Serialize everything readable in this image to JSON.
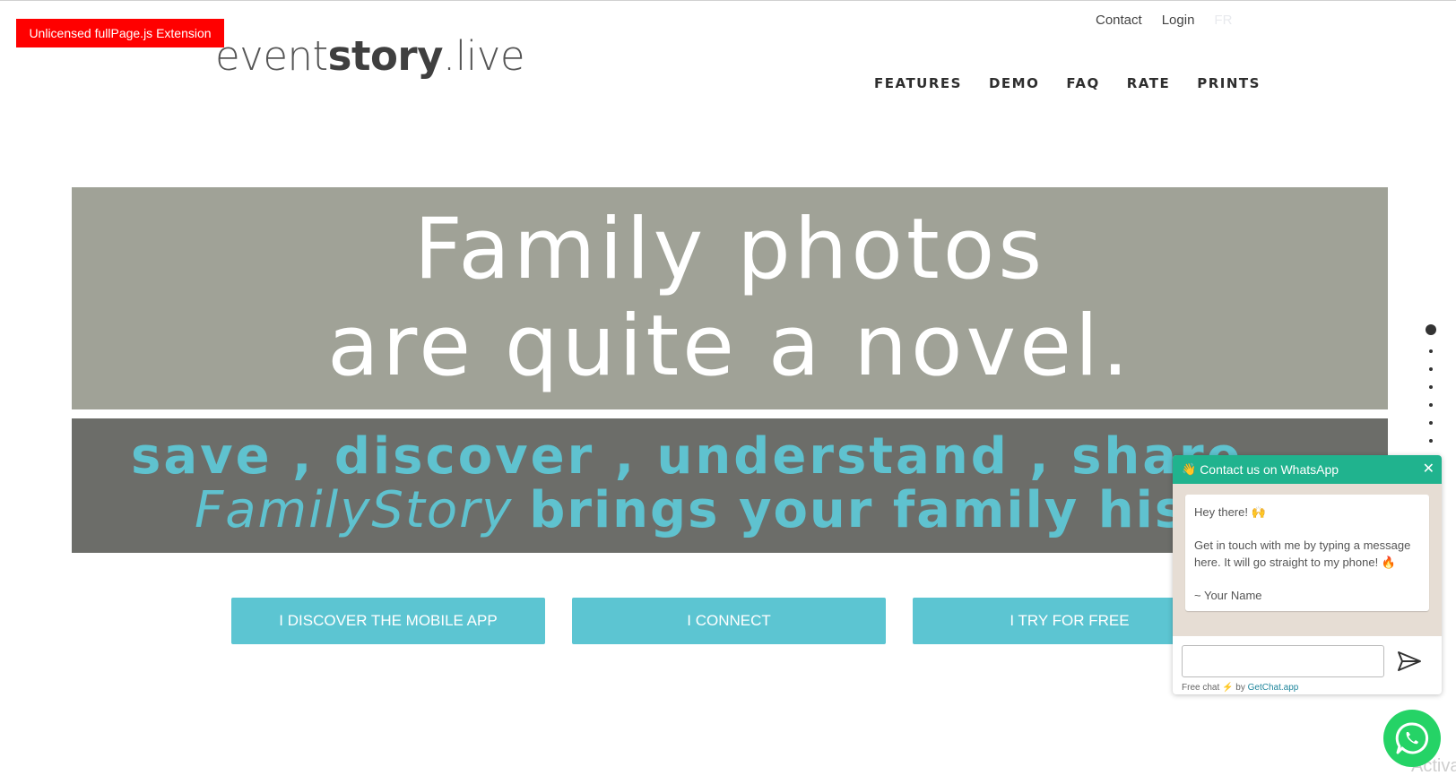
{
  "license_badge": "Unlicensed fullPage.js Extension",
  "logo": {
    "part1": "event",
    "part2": "story",
    "part3": ".live"
  },
  "top_links": {
    "contact": "Contact",
    "login": "Login",
    "lang": "FR"
  },
  "nav": [
    "FEATURES",
    "DEMO",
    "FAQ",
    "RATE",
    "PRINTS"
  ],
  "hero": {
    "headline_line1": "Family photos",
    "headline_line2": "are quite a novel.",
    "tagline_line1": "save , discover , understand , share ...",
    "tagline_brand": "FamilyStory",
    "tagline_line2": "brings your family history to"
  },
  "buttons": {
    "mobile_app": "I DISCOVER THE MOBILE APP",
    "connect": "I CONNECT",
    "try_free": "I TRY FOR FREE"
  },
  "section_dots": {
    "count": 8,
    "active_index": 0
  },
  "chat": {
    "header": "Contact us on WhatsApp",
    "greeting": "Hey there! 🙌",
    "message": "Get in touch with me by typing a message here. It will go straight to my phone! 🔥",
    "signature": "~ Your Name",
    "footer_prefix": "Free chat",
    "footer_by": "by",
    "footer_link": "GetChat.app"
  },
  "watermark": "Activa",
  "colors": {
    "accent": "#5cc5d2",
    "hero_top": "#a0a297",
    "hero_bottom": "#6c6d69",
    "whatsapp": "#25d366",
    "chat_header": "#20b38e",
    "badge": "#ff0000"
  },
  "icons": {
    "close": "close-icon",
    "send": "send-icon",
    "whatsapp": "whatsapp-icon",
    "wave": "wave-hand-icon"
  }
}
